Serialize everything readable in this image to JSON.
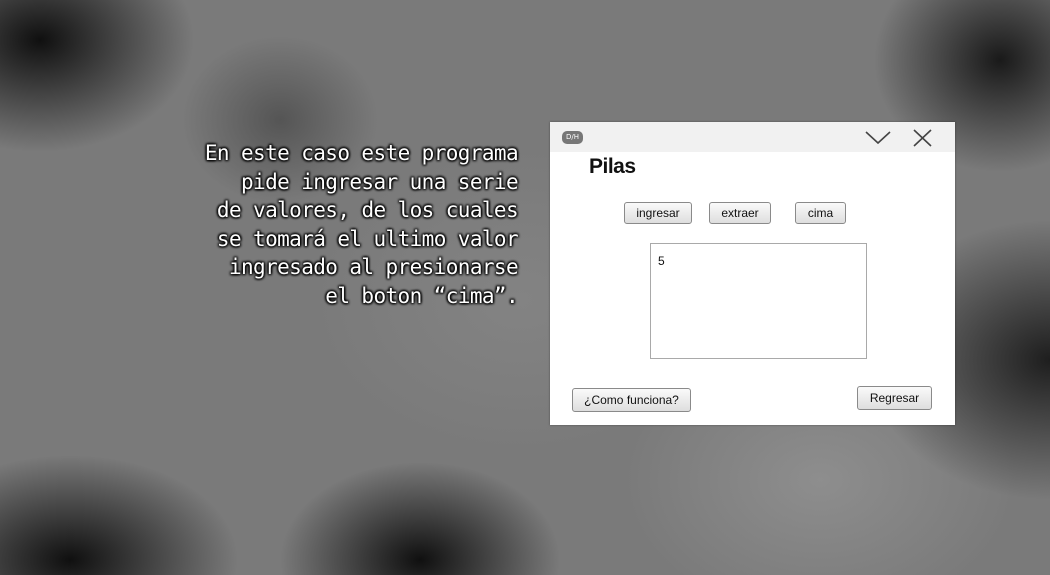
{
  "caption": {
    "lines": [
      "En este caso este programa",
      "pide ingresar una serie",
      "de valores, de los cuales",
      "se tomará el ultimo valor",
      "ingresado al presionarse",
      "el boton “cima”."
    ]
  },
  "window": {
    "badge": "D/H",
    "title": "Pilas",
    "controls": {
      "minimize_icon": "chevron-down-icon",
      "close_icon": "close-icon"
    },
    "buttons": {
      "ingresar": "ingresar",
      "extraer": "extraer",
      "cima": "cima"
    },
    "output_value": "5",
    "footer": {
      "help_label": "¿Como funciona?",
      "back_label": "Regresar"
    }
  }
}
